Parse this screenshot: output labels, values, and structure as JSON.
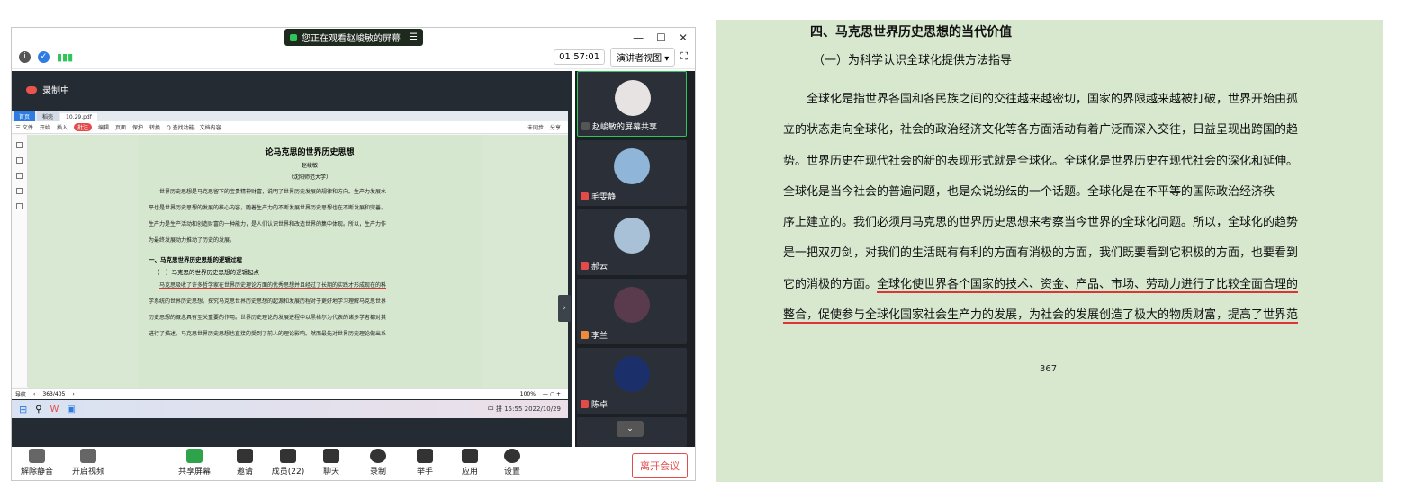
{
  "meeting": {
    "banner": "您正在观看赵峻敏的屏幕",
    "timer": "01:57:01",
    "view_mode": "演讲者视图",
    "recording": "录制中",
    "window_controls": [
      "—",
      "☐",
      "✕"
    ]
  },
  "pdf": {
    "tabs": [
      "首页",
      "稻壳",
      "10.29.pdf"
    ],
    "menu": [
      "三 文件",
      "开始",
      "插入",
      "批注",
      "编辑",
      "页面",
      "保护",
      "转换",
      "Q 查找功能、文档内容",
      "未同步",
      "分享"
    ],
    "title": "论马克思的世界历史思想",
    "author": "赵峻敏",
    "affiliation": "（沈阳师范大学）",
    "para1": [
      "世界历史思想是马克思留下的宝贵精神财富，说明了世界历史发展的规律和方向。生产力发展水",
      "平也是世界历史思想的发展的核心内容，随着生产力的不断发展世界历史思想也在不断发展和完善。",
      "生产力是生产活动和创造财富的一种能力，是人们认识世界和改造世界的集中体现。所以，生产力作",
      "为最终发展动力推动了历史的发展。"
    ],
    "heading1": "一、马克思世界历史思想的逻辑过程",
    "heading2": "（一）马克思的世界历史思想的逻辑起点",
    "para2": [
      "马克思吸收了许多哲学家在世界历史理论方面的优秀思想并且经过了长期的实践才形成现在的科",
      "学系统的世界历史思想。探究马克思世界历史思想的起源和发展历程对于更好地学习理解马克思世界",
      "历史思想的概念具有至关重要的作用。世界历史理论的发展进程中以黑格尔为代表的诸多学者都对其",
      "进行了描述。马克思世界历史思想也直接的受到了前人的理论影响。然而最先对世界历史理论做出系"
    ],
    "footer": {
      "nav": "导航",
      "page": "363/405",
      "zoom": "100%"
    }
  },
  "taskbar": {
    "time": "15:55",
    "date": "2022/10/29",
    "tray": "中 拼"
  },
  "participants": [
    {
      "name": "赵峻敏的屏幕共享",
      "color": "#e8e3e3"
    },
    {
      "name": "毛雯静",
      "color": "#8fb6d8"
    },
    {
      "name": "郝云",
      "color": "#a9c1d6"
    },
    {
      "name": "李兰",
      "color": "#5a3b4d"
    },
    {
      "name": "陈卓",
      "color": "#1b2f6b"
    }
  ],
  "controls": [
    "解除静音",
    "开启视频",
    "共享屏幕",
    "邀请",
    "成员(22)",
    "聊天",
    "录制",
    "举手",
    "应用",
    "设置"
  ],
  "leave": "离开会议",
  "doc": {
    "heading": "四、马克思世界历史思想的当代价值",
    "subheading": "（一）为科学认识全球化提供方法指导",
    "lines": [
      "　　全球化是指世界各国和各民族之间的交往越来越密切，国家的界限越来越被打破，世界开始由孤",
      "立的状态走向全球化，社会的政治经济文化等各方面活动有着广泛而深入交往，日益呈现出跨国的趋",
      "势。世界历史在现代社会的新的表现形式就是全球化。全球化是世界历史在现代社会的深化和延伸。",
      "全球化是当今社会的普遍问题，也是众说纷纭的一个话题。全球化是在不平等的国际政治经济秩",
      "序上建立的。我们必须用马克思的世界历史思想来考察当今世界的全球化问题。所以，全球化的趋势",
      "是一把双刃剑，对我们的生活既有有利的方面有消极的方面，我们既要看到它积极的方面，也要看到"
    ],
    "line7_a": "它的消极的方面。",
    "line7_b": "全球化使世界各个国家的技术、资金、产品、市场、劳动力进行了比较全面合理的",
    "line8": "整合，促使参与全球化国家社会生产力的发展，为社会的发展创造了极大的物质财富，提高了世界范",
    "page_number": "367"
  }
}
